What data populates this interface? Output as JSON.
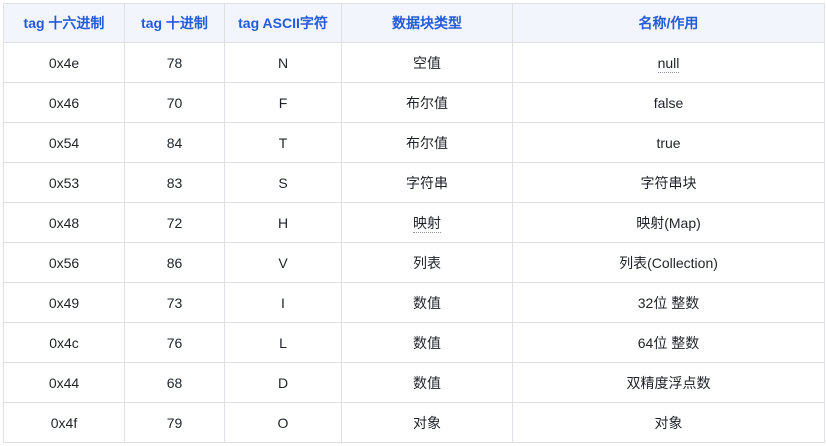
{
  "table": {
    "headers": [
      "tag 十六进制",
      "tag 十进制",
      "tag ASCII字符",
      "数据块类型",
      "名称/作用"
    ],
    "rows": [
      [
        "0x4e",
        "78",
        "N",
        "空值",
        "null"
      ],
      [
        "0x46",
        "70",
        "F",
        "布尔值",
        "false"
      ],
      [
        "0x54",
        "84",
        "T",
        "布尔值",
        "true"
      ],
      [
        "0x53",
        "83",
        "S",
        "字符串",
        "字符串块"
      ],
      [
        "0x48",
        "72",
        "H",
        "映射",
        "映射(Map)"
      ],
      [
        "0x56",
        "86",
        "V",
        "列表",
        "列表(Collection)"
      ],
      [
        "0x49",
        "73",
        "I",
        "数值",
        "32位 整数"
      ],
      [
        "0x4c",
        "76",
        "L",
        "数值",
        "64位 整数"
      ],
      [
        "0x44",
        "68",
        "D",
        "数值",
        "双精度浮点数"
      ],
      [
        "0x4f",
        "79",
        "O",
        "对象",
        "对象"
      ]
    ]
  },
  "colors": {
    "header_text": "#245bdb",
    "header_bg": "#f2f5fb",
    "border": "#dee0e3",
    "body_text": "#1f2329"
  }
}
